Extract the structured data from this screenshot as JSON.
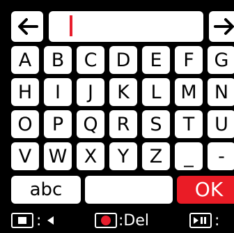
{
  "keyboard": {
    "rows": [
      [
        "A",
        "B",
        "C",
        "D",
        "E",
        "F",
        "G"
      ],
      [
        "H",
        "I",
        "J",
        "K",
        "L",
        "M",
        "N"
      ],
      [
        "O",
        "P",
        "Q",
        "R",
        "S",
        "T",
        "U"
      ],
      [
        "V",
        "W",
        "X",
        "Y",
        "Z",
        "_",
        "-"
      ]
    ],
    "abc_label": "abc",
    "space_label": "",
    "ok_label": "OK"
  },
  "input": {
    "value": ""
  },
  "bottom_bar": {
    "left_label": ":",
    "middle_label": ":Del",
    "right_label": ":"
  },
  "colors": {
    "accent": "#ea1c26",
    "background": "#000000",
    "key": "#ffffff"
  }
}
